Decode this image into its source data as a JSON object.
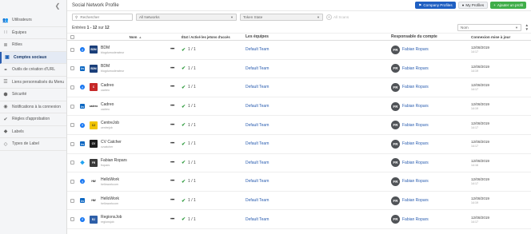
{
  "sidebar": {
    "items": [
      {
        "label": "Utilisateurs",
        "icon": "users-icon",
        "active": false
      },
      {
        "label": "Équipes",
        "icon": "team-icon",
        "active": false
      },
      {
        "label": "Rôles",
        "icon": "roles-icon",
        "active": false
      },
      {
        "label": "Comptes sociaux",
        "icon": "social-accounts-icon",
        "active": true
      },
      {
        "label": "Outils de création d'URL",
        "icon": "link-icon",
        "active": false
      },
      {
        "label": "Liens personnalisés du Menu",
        "icon": "menu-links-icon",
        "active": false
      },
      {
        "label": "Sécurité",
        "icon": "security-icon",
        "active": false
      },
      {
        "label": "Notifications à la connexion",
        "icon": "notification-icon",
        "active": false
      },
      {
        "label": "Règles d'approbation",
        "icon": "approval-icon",
        "active": false
      },
      {
        "label": "Labels",
        "icon": "label-icon",
        "active": false
      },
      {
        "label": "Types de Label",
        "icon": "label-type-icon",
        "active": false
      }
    ]
  },
  "header": {
    "title": "Social Network Profile",
    "buttons": {
      "company_profiles": "Company Profiles",
      "my_profiles": "My Profiles",
      "add_profile": "Ajouter un profil"
    }
  },
  "filters": {
    "search_placeholder": "Rechercher",
    "networks": "All Networks",
    "token_state": "Token State",
    "scans": "All Scans"
  },
  "entries": {
    "prefix": "Entrées",
    "range": "1 - 12",
    "middle": "sur",
    "total": "12"
  },
  "sort": {
    "value": "Nom"
  },
  "table": {
    "headers": {
      "name": "Nom",
      "state": "État / Activé les jetons d'accès",
      "teams": "Les équipes",
      "owner": "Responsable du compte",
      "last_login": "Connexion mise à jour"
    },
    "rows": [
      {
        "network": "facebook",
        "avatar_text": "BDM",
        "avatar_bg": "#1b3f7a",
        "name": "BDM",
        "handle": "blogdumoderateur",
        "access": "1 / 1",
        "team": "Default Team",
        "initials": "FR",
        "owner": "Fabian Ropars",
        "date": "12/08/2019",
        "time": "14:17"
      },
      {
        "network": "linkedin",
        "avatar_text": "BDM",
        "avatar_bg": "#1b3f7a",
        "name": "BDM",
        "handle": "blogdumoderateur",
        "access": "1 / 1",
        "team": "Default Team",
        "initials": "FR",
        "owner": "Fabian Ropars",
        "date": "12/08/2019",
        "time": "14:19"
      },
      {
        "network": "facebook",
        "avatar_text": "C",
        "avatar_bg": "#c62828",
        "name": "Cadreo",
        "handle": "cadreo",
        "access": "1 / 1",
        "team": "Default Team",
        "initials": "FR",
        "owner": "Fabian Ropars",
        "date": "12/08/2019",
        "time": "14:17"
      },
      {
        "network": "linkedin",
        "avatar_text": "cadreo",
        "avatar_bg": "#ffffff",
        "name": "Cadreo",
        "handle": "cadreo",
        "access": "1 / 1",
        "team": "Default Team",
        "initials": "FR",
        "owner": "Fabian Ropars",
        "date": "12/08/2019",
        "time": "14:19"
      },
      {
        "network": "facebook",
        "avatar_text": "CJ",
        "avatar_bg": "#f2c500",
        "name": "CentreJob",
        "handle": "centrejob",
        "access": "1 / 1",
        "team": "Default Team",
        "initials": "FR",
        "owner": "Fabian Ropars",
        "date": "12/08/2019",
        "time": "14:17"
      },
      {
        "network": "linkedin",
        "avatar_text": "CV",
        "avatar_bg": "#1d1d1d",
        "name": "CV Catcher",
        "handle": "cvcatcher",
        "access": "1 / 1",
        "team": "Default Team",
        "initials": "FR",
        "owner": "Fabian Ropars",
        "date": "12/08/2019",
        "time": "14:17"
      },
      {
        "network": "twitter",
        "avatar_text": "FR",
        "avatar_bg": "#3a3a3a",
        "name": "Fabian Ropars",
        "handle": "fropars",
        "access": "1 / 1",
        "team": "Default Team",
        "initials": "FR",
        "owner": "Fabian Ropars",
        "date": "12/08/2019",
        "time": "14:16"
      },
      {
        "network": "facebook",
        "avatar_text": "HW",
        "avatar_bg": "#ffffff",
        "name": "HelloWork",
        "handle": "helloworkcom",
        "access": "1 / 1",
        "team": "Default Team",
        "initials": "FR",
        "owner": "Fabian Ropars",
        "date": "12/08/2019",
        "time": "14:17"
      },
      {
        "network": "linkedin",
        "avatar_text": "HW",
        "avatar_bg": "#ffffff",
        "name": "HelloWork",
        "handle": "helloworkcom",
        "access": "1 / 1",
        "team": "Default Team",
        "initials": "FR",
        "owner": "Fabian Ropars",
        "date": "12/08/2019",
        "time": "14:19"
      },
      {
        "network": "facebook",
        "avatar_text": "RJ",
        "avatar_bg": "#2e5fa8",
        "name": "RegionsJob",
        "handle": "regionsjob",
        "access": "1 / 1",
        "team": "Default Team",
        "initials": "FR",
        "owner": "Fabian Ropars",
        "date": "12/08/2019",
        "time": "14:17"
      }
    ]
  },
  "colors": {
    "primary_blue": "#1f5fc2",
    "add_green": "#3fae49",
    "link_blue": "#2a5db0",
    "check_green": "#2e9a3d"
  }
}
